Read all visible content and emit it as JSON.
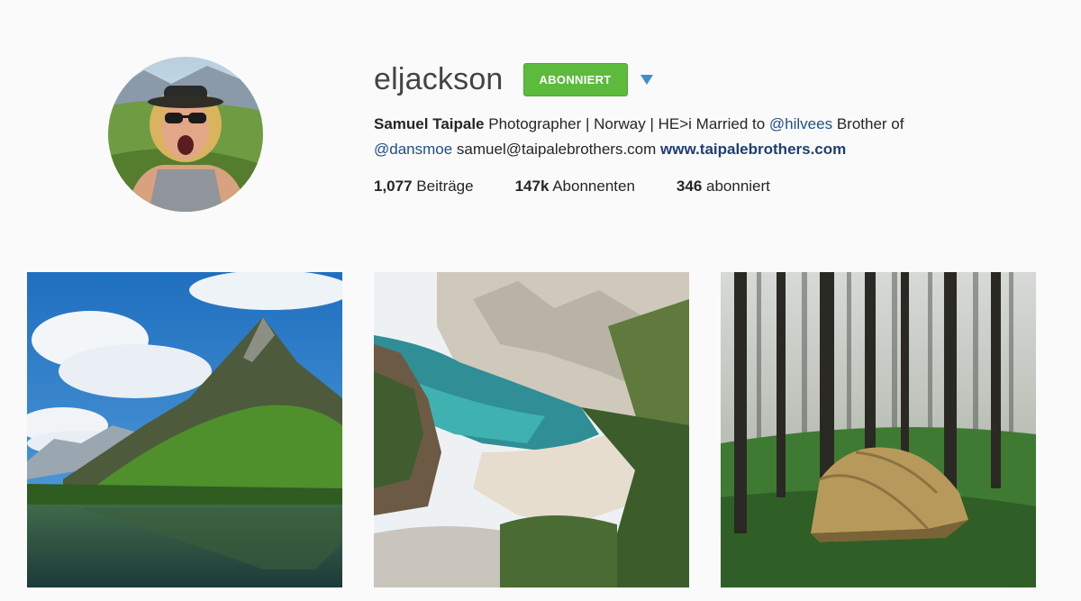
{
  "profile": {
    "username": "eljackson",
    "follow_label": "ABONNIERT",
    "dropdown_icon": "caret-down-icon",
    "avatar_alt": "profile photo",
    "bio": {
      "full_name": "Samuel Taipale",
      "text_1": " Photographer | Norway | HE>i Married to ",
      "mention_1": "@hilvees",
      "text_2": " Brother of",
      "mention_2": "@dansmoe",
      "email": " samuel@taipalebrothers.com ",
      "website": "www.taipalebrothers.com"
    },
    "stats": {
      "posts_count": "1,077",
      "posts_label": " Beiträge",
      "followers_count": "147k",
      "followers_label": " Abonnenten",
      "following_count": "346",
      "following_label": " abonniert"
    }
  },
  "posts": [
    {
      "subject": "mountain peak above a lake under a cloudy sky"
    },
    {
      "subject": "turquoise cove between limestone cliffs"
    },
    {
      "subject": "tent in a misty spruce forest"
    }
  ],
  "colors": {
    "background": "#fafafa",
    "follow_button": "#5cba3c",
    "caret": "#3d8fd1",
    "mention": "#1d4f8a",
    "link": "#1d3f73"
  }
}
